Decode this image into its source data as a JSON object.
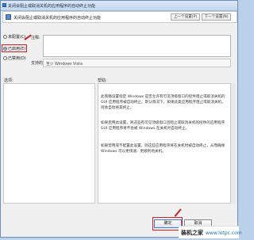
{
  "window": {
    "title": "关闭会阻止或取消关机的应用程序的自动终止功能"
  },
  "header": {
    "title": "关闭会阻止或取消关机的应用程序的自动终止功能",
    "prev_label": "上一个设置(P)",
    "next_label": "下一个设置(N)"
  },
  "options": {
    "not_configured": "未配置(C)",
    "enabled": "已启用(E)",
    "disabled": "已禁用(D)",
    "selected": "enabled"
  },
  "comment": {
    "label": "注释:"
  },
  "support": {
    "label": "支持的平台:",
    "value": "至少 Windows Vista"
  },
  "sections": {
    "options_label": "选项:",
    "help_label": "帮助:"
  },
  "help": {
    "paragraphs": [
      "此策略设置指定 Windows 是否允许有可见顶级窗口的控件阻止或取消关机的 GUI 应用程序被自动终止。默认情况下，如果此类应用程序阻止或取消关机，则会自动将其终止。",
      "如果启用此设置，则这些有可见顶级窗口且阻止或取消关机的控件的应用程序 GUI 应用程序将不会被 Windows 在关机时自动终止。",
      "如果禁用或不配置此设置，则这些应用程序将在关机时被自动终止，从而确保 Windows 可以更快速、更顺利地关机。"
    ]
  },
  "buttons": {
    "ok": "确定",
    "cancel": "取消",
    "apply": "应用(A)"
  },
  "watermark": {
    "text": "装机之家",
    "url": "www.lotpc.com"
  }
}
